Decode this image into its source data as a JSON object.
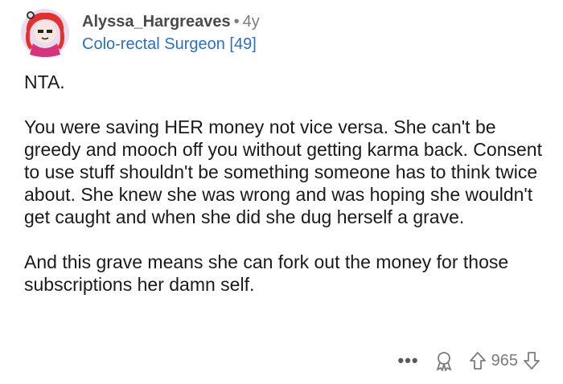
{
  "comment": {
    "username": "Alyssa_Hargreaves",
    "separator": "•",
    "age": "4y",
    "flair": "Colo-rectal Surgeon [49]",
    "paragraphs": [
      "NTA.",
      "You were saving HER money not vice versa. She can't be greedy and mooch off you without getting karma back. Consent to use stuff shouldn't be something someone has to think twice about. She knew she was wrong and was hoping she wouldn't get caught and when she did she dug herself a grave.",
      "And this grave means she can fork out the money for those subscriptions her damn self."
    ]
  },
  "actions": {
    "more_label": "•••",
    "score": "965"
  },
  "colors": {
    "flair": "#2b6fc2",
    "muted": "#7c7c7c",
    "avatar_bg": "#e8d8ee",
    "avatar_hair": "#e0322f"
  }
}
